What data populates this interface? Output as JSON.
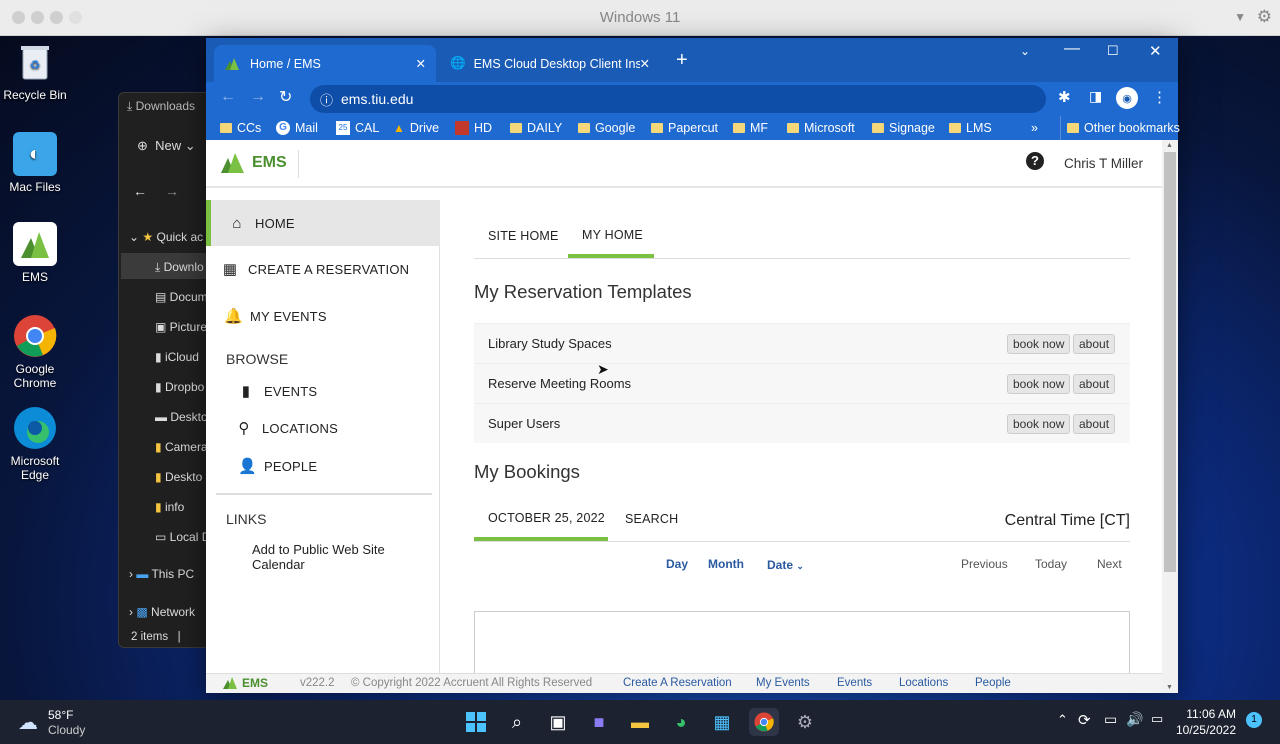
{
  "mac_window": {
    "title": "Windows 11"
  },
  "desktop": {
    "icons": [
      {
        "label": "Recycle Bin",
        "icon": "recycle-bin-icon"
      },
      {
        "label": "Mac Files",
        "icon": "mac-files-icon"
      },
      {
        "label": "EMS",
        "icon": "ems-icon"
      },
      {
        "label": "Google Chrome",
        "icon": "chrome-icon"
      },
      {
        "label": "Microsoft Edge",
        "icon": "edge-icon"
      }
    ]
  },
  "explorer": {
    "title": "Downloads",
    "new_label": "New",
    "quick_access": "Quick ac",
    "items": [
      "Downlo",
      "Docum",
      "Picture",
      "iCloud",
      "Dropbo",
      "Deskto",
      "Camera",
      "Deskto",
      "info",
      "Local D"
    ],
    "this_pc": "This PC",
    "network": "Network",
    "status": "2 items"
  },
  "browser": {
    "tabs": [
      {
        "title": "Home / EMS",
        "active": true
      },
      {
        "title": "EMS Cloud Desktop Client Install",
        "active": false
      }
    ],
    "url": "ems.tiu.edu",
    "bookmarks": [
      "CCs",
      "Mail",
      "CAL",
      "Drive",
      "HD",
      "DAILY",
      "Google",
      "Papercut",
      "MF",
      "Microsoft",
      "Signage",
      "LMS"
    ],
    "more_bookmarks": "»",
    "other_bookmarks": "Other bookmarks"
  },
  "ems": {
    "logo": "EMS",
    "user": "Chris T Miller",
    "nav": {
      "home": "HOME",
      "create": "CREATE A RESERVATION",
      "my_events": "MY EVENTS",
      "browse_heading": "BROWSE",
      "events": "EVENTS",
      "locations": "LOCATIONS",
      "people": "PEOPLE",
      "links_heading": "LINKS",
      "link_item": "Add to Public Web Site Calendar"
    },
    "tabs": {
      "site_home": "SITE HOME",
      "my_home": "MY HOME"
    },
    "templates_heading": "My Reservation Templates",
    "templates": [
      {
        "name": "Library Study Spaces",
        "book": "book now",
        "about": "about"
      },
      {
        "name": "Reserve Meeting Rooms",
        "book": "book now",
        "about": "about"
      },
      {
        "name": "Super Users",
        "book": "book now",
        "about": "about"
      }
    ],
    "bookings_heading": "My Bookings",
    "bookings_tabs": {
      "date": "OCTOBER 25, 2022",
      "search": "SEARCH"
    },
    "timezone": "Central Time [CT]",
    "calendar_controls": {
      "day": "Day",
      "month": "Month",
      "date": "Date",
      "previous": "Previous",
      "today": "Today",
      "next": "Next"
    },
    "footer": {
      "logo": "EMS",
      "version": "v222.2",
      "copyright": "© Copyright 2022 Accruent All Rights Reserved",
      "links": [
        "Create A Reservation",
        "My Events",
        "Events",
        "Locations",
        "People"
      ]
    },
    "accent_color": "#7ac143"
  },
  "taskbar": {
    "weather_temp": "58°F",
    "weather_desc": "Cloudy",
    "time": "11:06 AM",
    "date": "10/25/2022",
    "notification_count": "1"
  }
}
